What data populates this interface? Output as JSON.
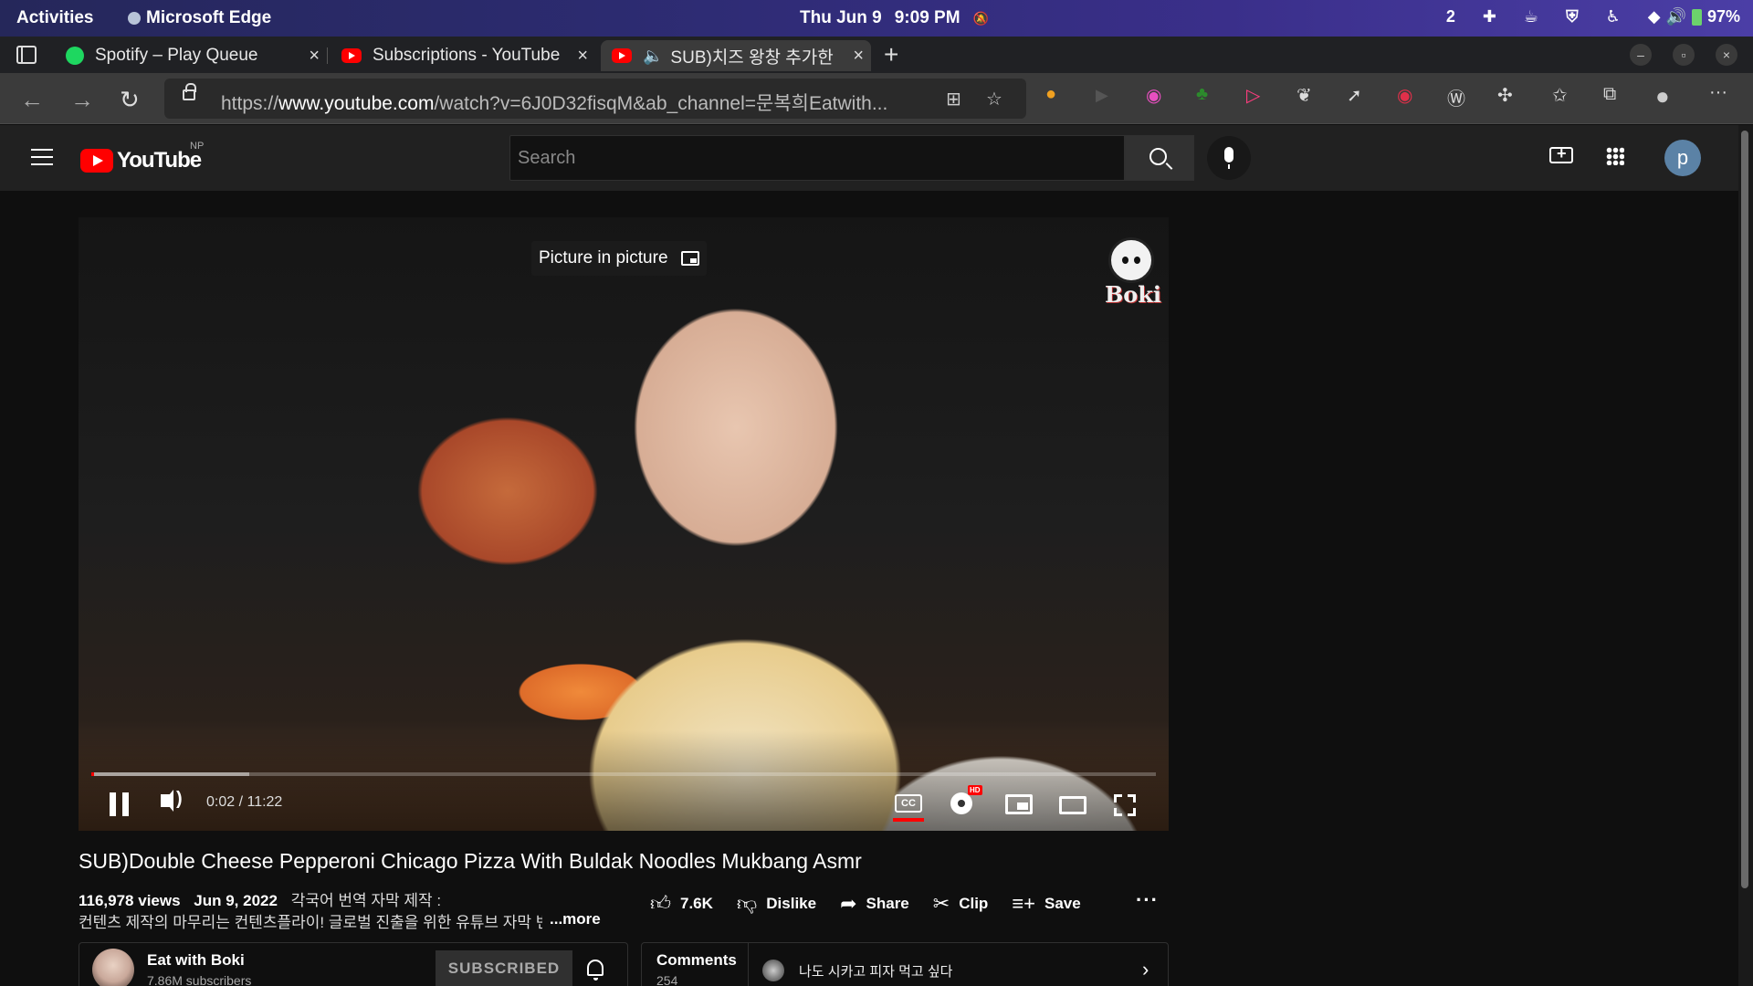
{
  "system_bar": {
    "activities": "Activities",
    "app_name": "Microsoft Edge",
    "date": "Thu Jun 9",
    "time": "9:09 PM",
    "workspace": "2",
    "battery": "97%"
  },
  "tabs": [
    {
      "title": "Spotify – Play Queue",
      "icon": "spotify-icon",
      "active": false
    },
    {
      "title": "Subscriptions - YouTube",
      "icon": "youtube-icon",
      "active": false
    },
    {
      "title": "SUB)치즈 왕창 추가한",
      "icon": "youtube-icon",
      "active": true,
      "audio": true
    }
  ],
  "address_bar": {
    "url_prefix": "https://",
    "url_host": "www.youtube.com",
    "url_rest": "/watch?v=6J0D32fisqM&ab_channel=문복희Eatwith..."
  },
  "youtube": {
    "logo_text": "YouTube",
    "region": "NP",
    "search_placeholder": "Search",
    "avatar_letter": "p"
  },
  "player": {
    "pip_tooltip": "Picture in picture",
    "watermark": "Boki",
    "time_current": "0:02",
    "time_total": "11:22",
    "time_display": "0:02 / 11:22",
    "progress_played_fraction": 0.003,
    "progress_loaded_fraction": 0.148,
    "hd_badge": "HD",
    "cc_label": "CC"
  },
  "video": {
    "title": "SUB)Double Cheese Pepperoni Chicago Pizza With Buldak Noodles Mukbang Asmr",
    "views": "116,978 views",
    "date": "Jun 9, 2022",
    "desc_line1": "각국어 번역 자막 제작 :",
    "desc_line2": "컨텐츠 제작의 마무리는 컨텐츠플라이! 글로벌 진출을 위한 유튜브 자막 번역 컨텐츠플라이",
    "more": "...more",
    "likes": "7.6K",
    "dislike": "Dislike",
    "share": "Share",
    "clip": "Clip",
    "save": "Save"
  },
  "channel": {
    "name": "Eat with Boki",
    "subscribers": "7.86M subscribers",
    "subscribe_label": "SUBSCRIBED"
  },
  "comments": {
    "label": "Comments",
    "count": "254",
    "top_comment": "나도 시카고 피자 먹고 싶다"
  }
}
